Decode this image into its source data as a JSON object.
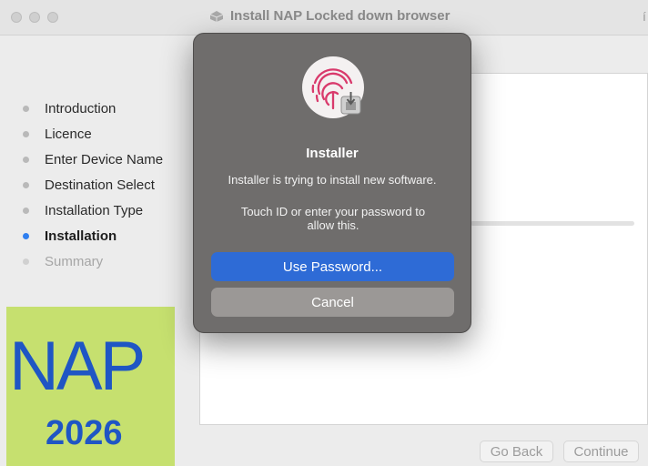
{
  "window": {
    "title": "Install NAP Locked down browser",
    "title_edge_char": "í"
  },
  "sidebar": {
    "steps": [
      {
        "label": "Introduction",
        "state": "done"
      },
      {
        "label": "Licence",
        "state": "done"
      },
      {
        "label": "Enter Device Name",
        "state": "done"
      },
      {
        "label": "Destination Select",
        "state": "done"
      },
      {
        "label": "Installation Type",
        "state": "done"
      },
      {
        "label": "Installation",
        "state": "current"
      },
      {
        "label": "Summary",
        "state": "future"
      }
    ]
  },
  "logo": {
    "text": "NAP",
    "year": "2026"
  },
  "installation": {
    "progress": 0
  },
  "footer": {
    "back_label": "Go Back",
    "continue_label": "Continue"
  },
  "dialog": {
    "title": "Installer",
    "message": "Installer is trying to install new software.",
    "hint": "Touch ID or enter your password to allow this.",
    "primary_label": "Use Password...",
    "cancel_label": "Cancel",
    "icon": "touch-id-fingerprint-icon"
  },
  "colors": {
    "accent": "#2f7ff0",
    "dialog_bg": "#6f6d6c",
    "primary_button": "#2e6bd6",
    "logo_bg": "#c6e06f",
    "logo_text": "#1f56c4"
  }
}
